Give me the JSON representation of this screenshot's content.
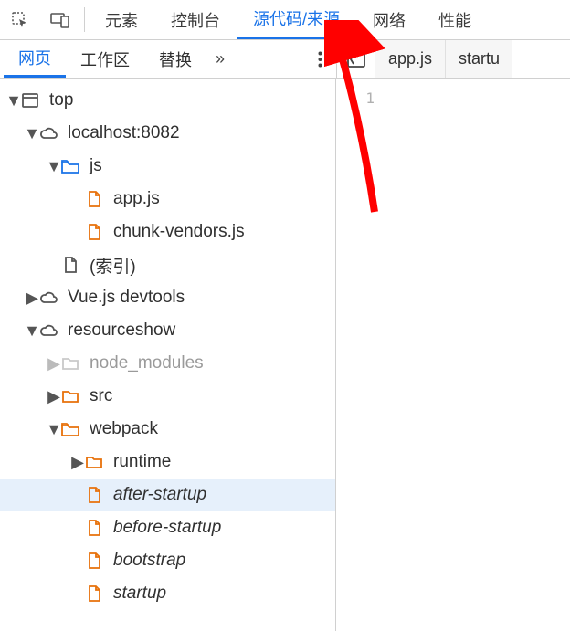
{
  "topbar": {
    "elements": "元素",
    "console": "控制台",
    "sources": "源代码/来源",
    "network": "网络",
    "performance": "性能"
  },
  "subnav": {
    "page": "网页",
    "workspace": "工作区",
    "overrides": "替换",
    "more": "»"
  },
  "file_tabs": {
    "tab1": "app.js",
    "tab2": "startu"
  },
  "editor": {
    "line1": "1"
  },
  "tree": {
    "top": "top",
    "localhost": "localhost:8082",
    "js": "js",
    "appjs": "app.js",
    "chunk": "chunk-vendors.js",
    "index": "(索引)",
    "vuedev": "Vue.js devtools",
    "resourceshow": "resourceshow",
    "nodemodules": "node_modules",
    "src": "src",
    "webpack": "webpack",
    "runtime": "runtime",
    "after": "after-startup",
    "before": "before-startup",
    "bootstrap": "bootstrap",
    "startup": "startup"
  }
}
